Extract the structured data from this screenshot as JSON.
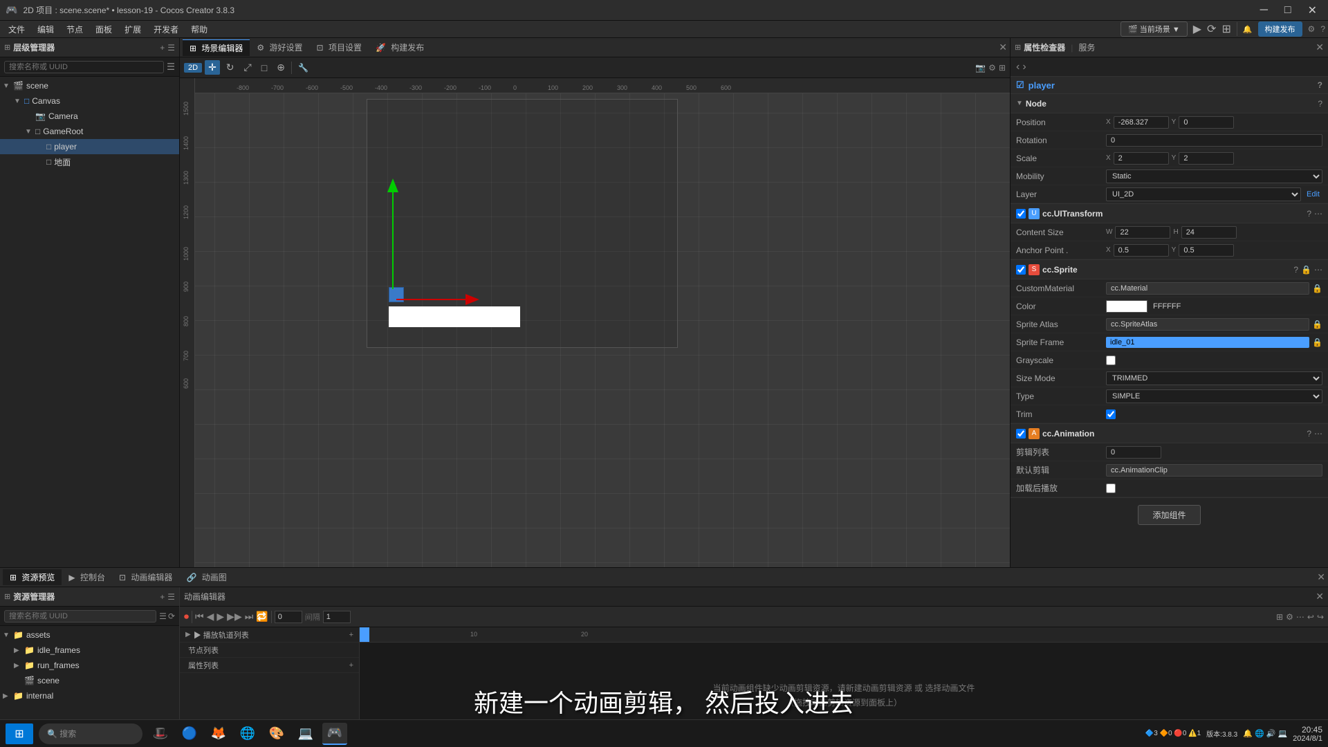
{
  "app": {
    "title": "2D 项目 : scene.scene* • lesson-19 - Cocos Creator 3.8.3"
  },
  "menubar": {
    "items": [
      "文件",
      "编辑",
      "节点",
      "面板",
      "扩展",
      "开发者",
      "帮助"
    ]
  },
  "toolbar": {
    "scene_selector": "当前场景",
    "publish_btn": "构建发布"
  },
  "hierarchy": {
    "title": "层级管理器",
    "search_placeholder": "搜索名称或 UUID",
    "items": [
      {
        "label": "scene",
        "indent": 0,
        "type": "scene",
        "expanded": true
      },
      {
        "label": "Canvas",
        "indent": 1,
        "type": "canvas",
        "expanded": true
      },
      {
        "label": "Camera",
        "indent": 2,
        "type": "camera"
      },
      {
        "label": "GameRoot",
        "indent": 2,
        "type": "folder",
        "expanded": true
      },
      {
        "label": "player",
        "indent": 3,
        "type": "node",
        "selected": true
      },
      {
        "label": "地面",
        "indent": 3,
        "type": "node"
      }
    ]
  },
  "scene_editor": {
    "tabs": [
      "场景编辑器",
      "游好设置",
      "项目设置",
      "构建发布"
    ],
    "active_tab": "场景编辑器",
    "view_mode": "2D"
  },
  "properties": {
    "nav_back": "‹",
    "nav_forward": "›",
    "node_name": "player",
    "node_section": {
      "title": "Node",
      "position": {
        "label": "Position",
        "x": "-268.327",
        "y": "0"
      },
      "rotation": {
        "label": "Rotation",
        "value": "0"
      },
      "scale": {
        "label": "Scale",
        "x": "2",
        "y": "2"
      },
      "mobility": {
        "label": "Mobility",
        "value": "Static"
      },
      "layer": {
        "label": "Layer",
        "value": "UI_2D",
        "edit": "Edit"
      }
    },
    "ui_transform": {
      "title": "cc.UITransform",
      "content_size": {
        "label": "Content Size",
        "w": "22",
        "h": "24"
      },
      "anchor_point": {
        "label": "Anchor Point .",
        "x": "0.5",
        "y": "0.5"
      }
    },
    "sprite": {
      "title": "cc.Sprite",
      "custom_material": {
        "label": "CustomMaterial",
        "value": "cc.Material"
      },
      "color": {
        "label": "Color",
        "hex": "FFFFFF"
      },
      "sprite_atlas": {
        "label": "Sprite Atlas",
        "value": "cc.SpriteAtlas"
      },
      "sprite_frame": {
        "label": "Sprite Frame",
        "value": "idle_01"
      },
      "grayscale": {
        "label": "Grayscale"
      },
      "size_mode": {
        "label": "Size Mode",
        "value": "TRIMMED"
      },
      "type": {
        "label": "Type",
        "value": "SIMPLE"
      },
      "trim": {
        "label": "Trim"
      }
    },
    "animation": {
      "title": "cc.Animation",
      "clip_list": {
        "label": "剪辑列表",
        "value": "0"
      },
      "default_clip": {
        "label": "默认剪辑",
        "value": "cc.AnimationClip"
      },
      "auto_play": {
        "label": "加载后播放"
      }
    },
    "add_component_btn": "添加组件"
  },
  "assets": {
    "title": "资源管理器",
    "search_placeholder": "搜索名称或 UUID",
    "items": [
      {
        "label": "assets",
        "indent": 0,
        "type": "folder",
        "expanded": true
      },
      {
        "label": "idle_frames",
        "indent": 1,
        "type": "folder",
        "expanded": false
      },
      {
        "label": "run_frames",
        "indent": 1,
        "type": "folder",
        "expanded": false
      },
      {
        "label": "scene",
        "indent": 1,
        "type": "scene"
      },
      {
        "label": "internal",
        "indent": 0,
        "type": "folder"
      }
    ]
  },
  "animation_editor": {
    "tabs": [
      "资源预览",
      "控制台",
      "动画编辑器",
      "动画图"
    ],
    "active_tab": "动画编辑器",
    "tracks": [
      {
        "label": "▶ 播放轨道列表",
        "add": true
      },
      {
        "label": "节点列表"
      },
      {
        "label": "属性列表"
      }
    ],
    "empty_msg_line1": "当前动画组件缺少动画剪辑资源，请新建动画剪辑资源 或 选择动画文件",
    "empty_msg_line2": "（拖拽动画剪辑资源到面板上）",
    "frame_count": "1",
    "current_frame": "0"
  },
  "subtitle": {
    "text": "新建一个动画剪辑，  然后投入进去"
  },
  "taskbar": {
    "time": "20:45",
    "date": "2024/8/1",
    "notifications": "🔔3  🔔1  🔔0  🔔1"
  },
  "status_bar": {
    "version": "版本:3.8.3",
    "icons": "🔷3 🔶0 🔴0 ⚠️1"
  }
}
